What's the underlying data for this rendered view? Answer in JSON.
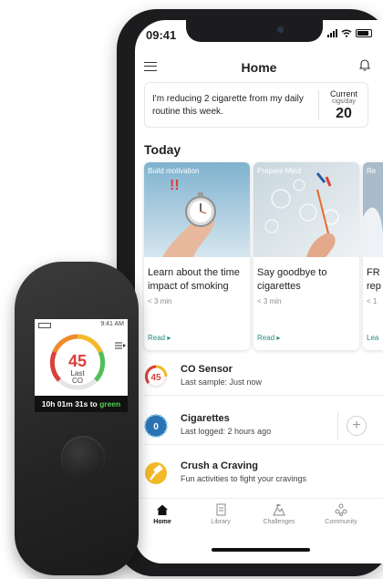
{
  "status_bar": {
    "time": "09:41"
  },
  "header": {
    "title": "Home"
  },
  "goal": {
    "message": "I'm reducing 2 cigarette from my daily routine this week.",
    "current_label": "Current",
    "unit_label": "cigs/day",
    "current_value": "20"
  },
  "today": {
    "title": "Today",
    "cards": [
      {
        "tag": "Build motivation",
        "title": "Learn about the time impact of smoking",
        "duration": "< 3 min",
        "action": "Read ▸"
      },
      {
        "tag": "Prepare Mind",
        "title": "Say goodbye to cigarettes",
        "duration": "< 3 min",
        "action": "Read ▸"
      },
      {
        "tag": "Re",
        "title": "FR rep",
        "duration": "< 1",
        "action": "Lea"
      }
    ]
  },
  "list": [
    {
      "icon_value": "45",
      "title": "CO Sensor",
      "subtitle": "Last sample: Just now"
    },
    {
      "icon_value": "0",
      "title": "Cigarettes",
      "subtitle": "Last logged: 2 hours ago",
      "add_label": "+"
    },
    {
      "title": "Crush a Craving",
      "subtitle": "Fun activities to fight your cravings"
    }
  ],
  "tabs": [
    {
      "label": "Home",
      "icon": "home-icon"
    },
    {
      "label": "Library",
      "icon": "library-icon"
    },
    {
      "label": "Challenges",
      "icon": "challenges-icon"
    },
    {
      "label": "Community",
      "icon": "community-icon"
    }
  ],
  "device": {
    "time": "9:41 AM",
    "co_value": "45",
    "last_label": "Last",
    "co_label": "CO",
    "timer_prefix": "10h 01m 31s to ",
    "timer_target": "green"
  },
  "colors": {
    "accent": "#1f8f7c",
    "co_red": "#d9413a",
    "cig_blue": "#2a73b5",
    "craving_yellow": "#f4b928",
    "timer_green": "#4fd04f"
  }
}
